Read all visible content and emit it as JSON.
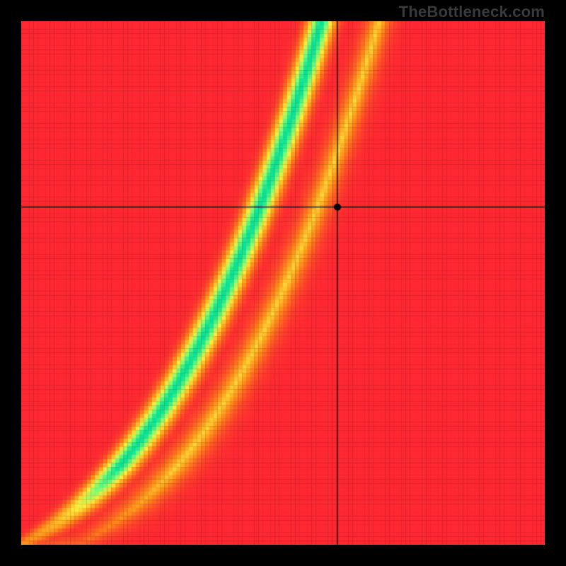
{
  "watermark": "TheBottleneck.com",
  "chart_data": {
    "type": "heatmap",
    "title": "",
    "xlabel": "",
    "ylabel": "",
    "xlim": [
      0,
      1
    ],
    "ylim": [
      0,
      1
    ],
    "crosshair": {
      "x": 0.604,
      "y": 0.645
    },
    "marker": {
      "x": 0.604,
      "y": 0.645
    },
    "optimal_curve_description": "narrow green band running from lower-left to upper-right, convex-upward; surrounded by yellow fading into orange then red toward the left and right extremes",
    "color_scale_note": "0 = red (far from optimal), 0.5 = orange/yellow, 1 = green (optimal)"
  }
}
